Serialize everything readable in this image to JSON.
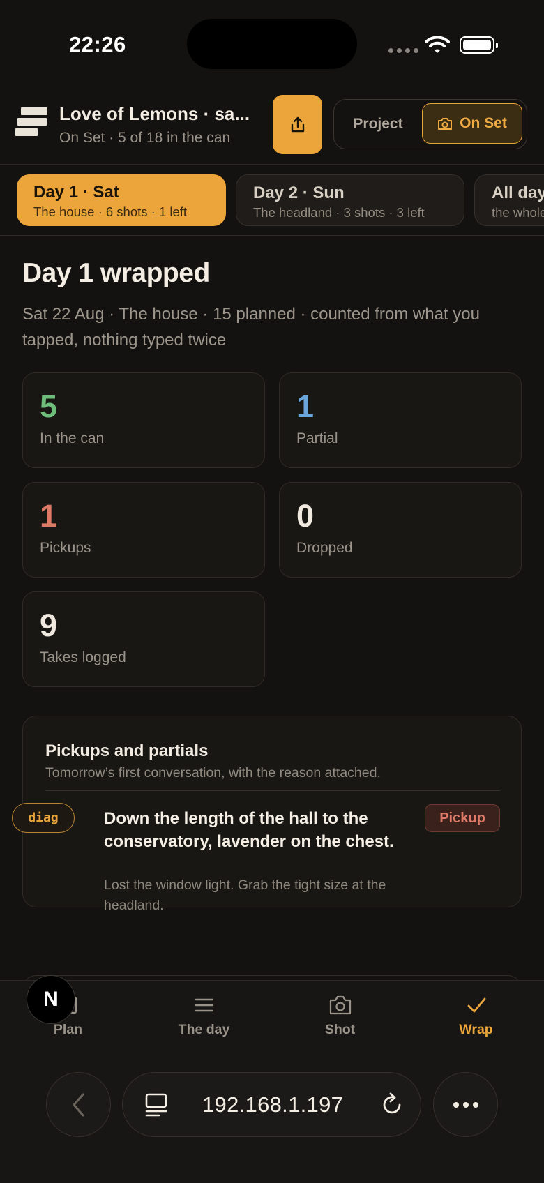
{
  "status_bar": {
    "time": "22:26"
  },
  "header": {
    "project_title": "Love of Lemons · sa...",
    "project_subtitle": "On Set · 5 of 18 in the can",
    "share_icon": "share-icon",
    "mode_project_label": "Project",
    "mode_onset_label": "On Set",
    "onset_icon": "camera-icon"
  },
  "day_tabs": [
    {
      "title": "Day 1 · Sat",
      "subtitle": "The house · 6 shots · 1 left",
      "active": true
    },
    {
      "title": "Day 2 · Sun",
      "subtitle": "The headland · 3 shots · 3 left",
      "active": false
    },
    {
      "title": "All days",
      "subtitle": "the whole",
      "active": false
    }
  ],
  "wrap": {
    "title": "Day 1 wrapped",
    "subtitle": "Sat 22 Aug · The house · 15 planned · counted from what you tapped, nothing typed twice"
  },
  "stats": [
    {
      "value": "5",
      "label": "In the can",
      "color": "#6fbd7a"
    },
    {
      "value": "1",
      "label": "Partial",
      "color": "#6aa5dc"
    },
    {
      "value": "1",
      "label": "Pickups",
      "color": "#dd7966"
    },
    {
      "value": "0",
      "label": "Dropped",
      "color": "#efe9df"
    },
    {
      "value": "9",
      "label": "Takes logged",
      "color": "#efe9df"
    }
  ],
  "pickups_card": {
    "title": "Pickups and partials",
    "subtitle": "Tomorrow’s first conversation, with the reason attached.",
    "items": [
      {
        "tag": "diag",
        "title": "Down the length of the hall to the conservatory, lavender on the chest.",
        "note": "Lost the window light. Grab the tight size at the headland.",
        "badge": "Pickup"
      }
    ]
  },
  "tab_bar": [
    {
      "label": "Plan",
      "icon": "plan-icon",
      "active": false
    },
    {
      "label": "The day",
      "icon": "list-icon",
      "active": false
    },
    {
      "label": "Shot",
      "icon": "camera-icon",
      "active": false
    },
    {
      "label": "Wrap",
      "icon": "checkmark-icon",
      "active": true
    }
  ],
  "overlay_badge": "N",
  "browser": {
    "address": "192.168.1.197"
  },
  "colors": {
    "accent": "#eba53a",
    "background": "#141210"
  }
}
